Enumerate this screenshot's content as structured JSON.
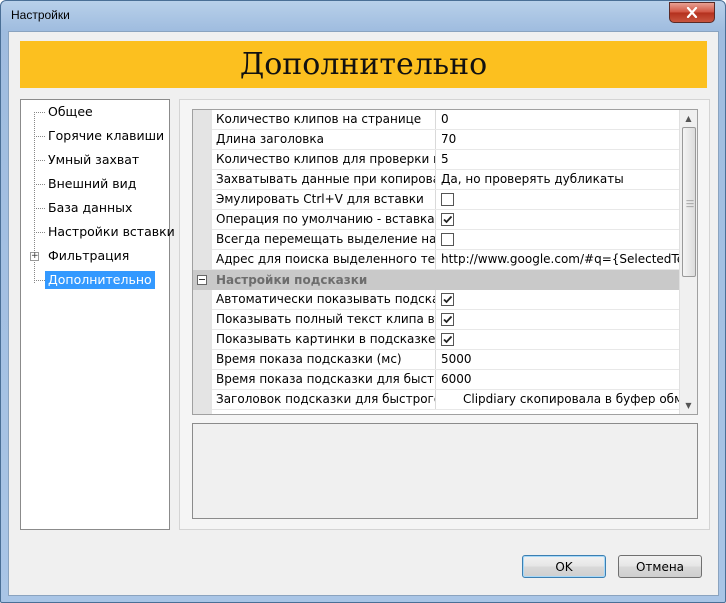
{
  "window": {
    "title": "Настройки"
  },
  "banner": {
    "title": "Дополнительно"
  },
  "tree": {
    "items": [
      {
        "label": "Общее",
        "selected": false
      },
      {
        "label": "Горячие клавиши",
        "selected": false
      },
      {
        "label": "Умный захват",
        "selected": false
      },
      {
        "label": "Внешний вид",
        "selected": false
      },
      {
        "label": "База данных",
        "selected": false
      },
      {
        "label": "Настройки вставки",
        "selected": false
      },
      {
        "label": "Фильтрация",
        "selected": false,
        "expandable": true
      },
      {
        "label": "Дополнительно",
        "selected": true
      }
    ]
  },
  "grid": {
    "rows1": [
      {
        "name": "Количество клипов на странице",
        "value": "0"
      },
      {
        "name": "Длина заголовка",
        "value": "70"
      },
      {
        "name": "Количество клипов для проверки на дубли",
        "value": "5"
      },
      {
        "name": "Захватывать данные при копировании к",
        "value": "Да, но проверять дубликаты"
      },
      {
        "name": "Эмулировать Ctrl+V для вставки",
        "checked": false
      },
      {
        "name": "Операция по умолчанию - вставка клип",
        "checked": true
      },
      {
        "name": "Всегда перемещать выделение на после",
        "checked": false
      },
      {
        "name": "Адрес для поиска выделенного текста в",
        "value": "http://www.google.com/#q={SelectedText}"
      }
    ],
    "category": "Настройки подсказки",
    "rows2": [
      {
        "name": "Автоматически показывать подсказку п",
        "checked": true
      },
      {
        "name": "Показывать полный текст клипа в подск",
        "checked": true
      },
      {
        "name": "Показывать картинки в подсказке",
        "checked": true
      },
      {
        "name": "Время показа подсказки (мс)",
        "value": "5000"
      },
      {
        "name": "Время показа подсказки для быстрого к",
        "value": "6000"
      },
      {
        "name": "Заголовок подсказки для быстрого копи",
        "value": "Clipdiary скопировала в буфер обмена"
      }
    ]
  },
  "buttons": {
    "ok": "OK",
    "cancel": "Отмена"
  },
  "icons": {
    "close": "close-icon",
    "scroll_up": "arrow-up-icon",
    "scroll_down": "arrow-down-icon",
    "check": "check-icon"
  },
  "colors": {
    "banner": "#fcc01f",
    "selection": "#3399ff",
    "category": "#c9c9c9"
  }
}
